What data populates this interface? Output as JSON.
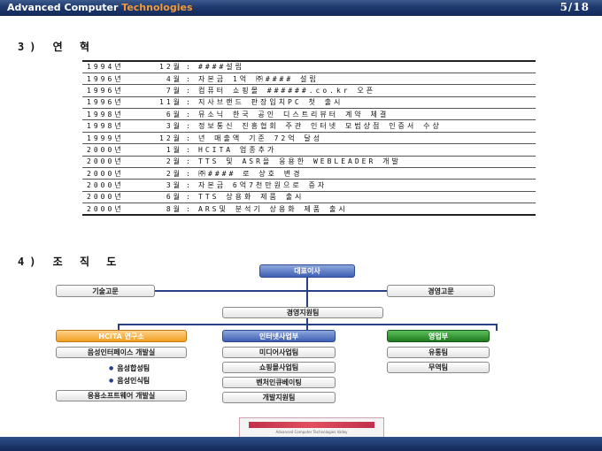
{
  "header": {
    "brand_main": "Advanced Computer ",
    "brand_accent": "Technologies",
    "page": "5/18"
  },
  "history": {
    "heading": "3) 연 혁",
    "rows": [
      {
        "year": "1994년",
        "month": "12월",
        "sep": ":",
        "text": "####설립"
      },
      {
        "year": "1996년",
        "month": "4월",
        "sep": ":",
        "text": "자본금 1억 ㈜#### 설립"
      },
      {
        "year": "1996년",
        "month": "7월",
        "sep": ":",
        "text": "컴퓨터 쇼핑몰 ######.co.kr 오픈"
      },
      {
        "year": "1996년",
        "month": "11월",
        "sep": ":",
        "text": "지사브랜드 판장입치PC 첫 출시"
      },
      {
        "year": "1998년",
        "month": "6월",
        "sep": ":",
        "text": "뮤소닉 한국 공인 디스트리뷰터 계약 체결"
      },
      {
        "year": "1998년",
        "month": "3월",
        "sep": ":",
        "text": "정보통신 진흥협회 주관 인터넷 모범상점 인증서 수상"
      },
      {
        "year": "1999년",
        "month": "12월",
        "sep": ":",
        "text": "년 매출액 기준 72억 달성"
      },
      {
        "year": "2000년",
        "month": "1월",
        "sep": ":",
        "text": "HCITA 업종추가"
      },
      {
        "year": "2000년",
        "month": "2월",
        "sep": ":",
        "text": "TTS 및 ASR을 응용한 WEBLEADER 개발"
      },
      {
        "year": "2000년",
        "month": "2월",
        "sep": ":",
        "text": "㈜#### 로 상호 변경"
      },
      {
        "year": "2000년",
        "month": "3월",
        "sep": ":",
        "text": "자본금 6억7천만원으로 증자"
      },
      {
        "year": "2000년",
        "month": "6월",
        "sep": ":",
        "text": "TTS 상용화 제품 출시"
      },
      {
        "year": "2000년",
        "month": "8월",
        "sep": ":",
        "text": "ARS및 분석기 상용화 제품 출시"
      }
    ]
  },
  "org": {
    "heading": "4) 조 직 도",
    "ceo": "대표이사",
    "tech_advisor": "기술고문",
    "mgmt_advisor": "경영고문",
    "support": "경영지원팀",
    "lab": "HCITA 연구소",
    "internet": "인터넷사업부",
    "sales": "영업부",
    "lab_items": [
      "음성인터페이스 개발실",
      "음성합성팀",
      "음성인식팀",
      "응용소프트웨어 개발실"
    ],
    "internet_items": [
      "미디어사업팀",
      "쇼핑몰사업팀",
      "벤처인큐베이팅",
      "개발지원팀"
    ],
    "sales_items": [
      "유통팀",
      "무역팀"
    ]
  },
  "footer": {
    "logo_tagline": "Advanced Computer Technologies Valley"
  }
}
